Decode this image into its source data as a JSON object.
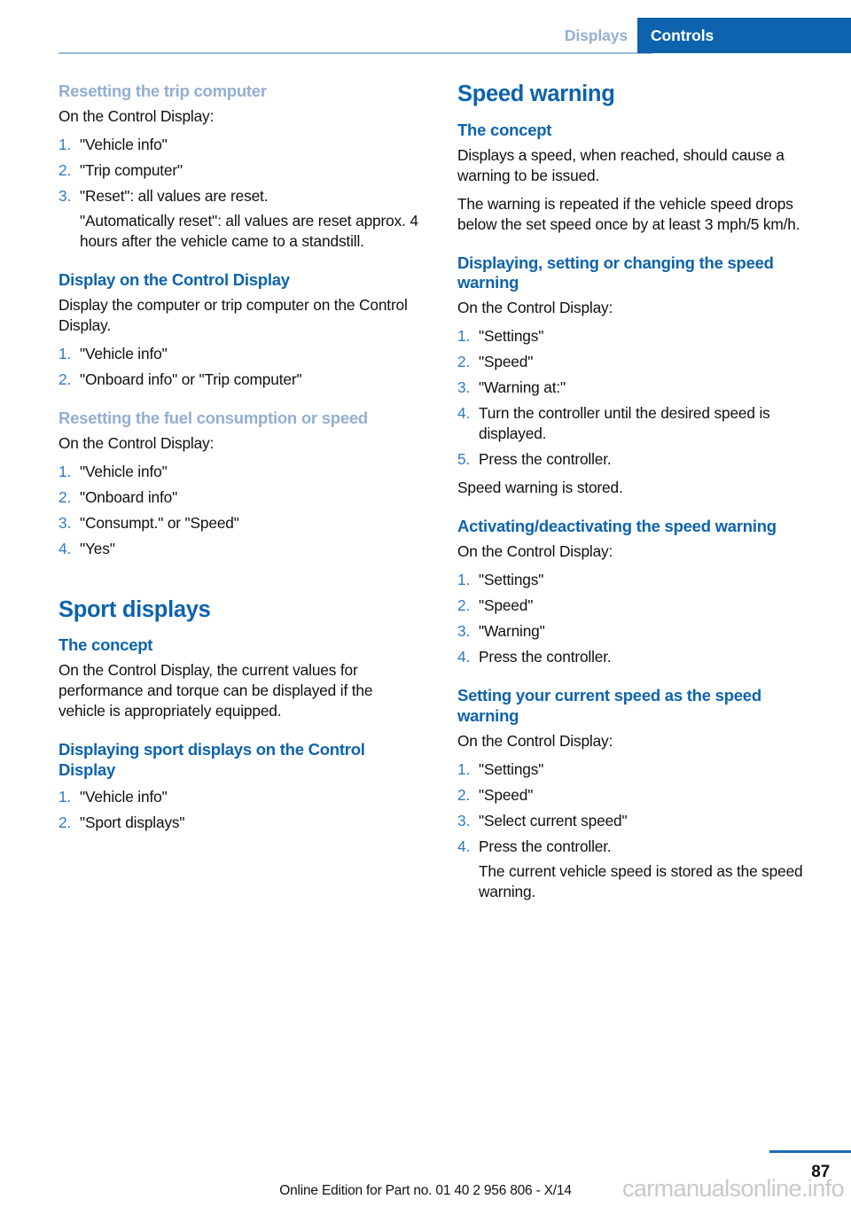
{
  "header": {
    "tab_inactive": "Displays",
    "tab_active": "Controls",
    "accent_blue": "#0d63ad",
    "muted_blue": "#92aed3",
    "rule_blue": "#9db9da"
  },
  "left_column": {
    "s1": {
      "heading": "Resetting the trip computer",
      "heading_style": "muted",
      "intro": "On the Control Display:",
      "steps": [
        {
          "text": "\"Vehicle info\""
        },
        {
          "text": "\"Trip computer\""
        },
        {
          "text": "\"Reset\": all values are reset.",
          "cont": "\"Automatically reset\": all values are reset approx. 4 hours after the vehicle came to a standstill."
        }
      ]
    },
    "s2": {
      "heading": "Display on the Control Display",
      "heading_style": "normal",
      "intro": "Display the computer or trip computer on the Control Display.",
      "steps": [
        {
          "text": "\"Vehicle info\""
        },
        {
          "text": "\"Onboard info\" or \"Trip computer\""
        }
      ]
    },
    "s3": {
      "heading": "Resetting the fuel consumption or speed",
      "heading_style": "muted",
      "intro": "On the Control Display:",
      "steps": [
        {
          "text": "\"Vehicle info\""
        },
        {
          "text": "\"Onboard info\""
        },
        {
          "text": "\"Consumpt.\" or \"Speed\""
        },
        {
          "text": "\"Yes\""
        }
      ]
    },
    "s4": {
      "title": "Sport displays",
      "heading": "The concept",
      "intro": "On the Control Display, the current values for performance and torque can be displayed if the vehicle is appropriately equipped."
    },
    "s5": {
      "heading": "Displaying sport displays on the Control Display",
      "steps": [
        {
          "text": "\"Vehicle info\""
        },
        {
          "text": "\"Sport displays\""
        }
      ]
    }
  },
  "right_column": {
    "s1": {
      "title": "Speed warning",
      "heading": "The concept",
      "para1": "Displays a speed, when reached, should cause a warning to be issued.",
      "para2": "The warning is repeated if the vehicle speed drops below the set speed once by at least 3 mph/5 km/h."
    },
    "s2": {
      "heading": "Displaying, setting or changing the speed warning",
      "intro": "On the Control Display:",
      "steps": [
        {
          "text": "\"Settings\""
        },
        {
          "text": "\"Speed\""
        },
        {
          "text": "\"Warning at:\""
        },
        {
          "text": "Turn the controller until the desired speed is displayed."
        },
        {
          "text": "Press the controller."
        }
      ],
      "outro": "Speed warning is stored."
    },
    "s3": {
      "heading": "Activating/deactivating the speed warning",
      "intro": "On the Control Display:",
      "steps": [
        {
          "text": "\"Settings\""
        },
        {
          "text": "\"Speed\""
        },
        {
          "text": "\"Warning\""
        },
        {
          "text": "Press the controller."
        }
      ]
    },
    "s4": {
      "heading": "Setting your current speed as the speed warning",
      "intro": "On the Control Display:",
      "steps": [
        {
          "text": "\"Settings\""
        },
        {
          "text": "\"Speed\""
        },
        {
          "text": "\"Select current speed\""
        },
        {
          "text": "Press the controller.",
          "cont": "The current vehicle speed is stored as the speed warning."
        }
      ]
    }
  },
  "footer": {
    "note": "Online Edition for Part no. 01 40 2 956 806 - X/14",
    "page_number": "87",
    "watermark": "carmanualsonline.info"
  }
}
